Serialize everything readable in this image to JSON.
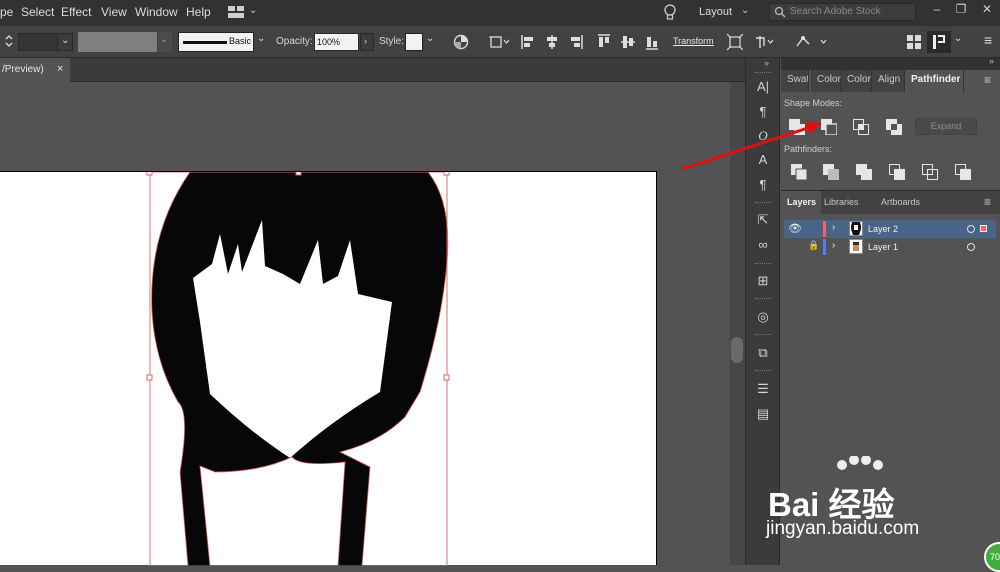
{
  "menubar": {
    "items": [
      "pe",
      "Select",
      "Effect",
      "View",
      "Window",
      "Help"
    ],
    "workspace": "Layout",
    "search_placeholder": "Search Adobe Stock"
  },
  "controlbar": {
    "stroke_style": "Basic",
    "opacity_label": "Opacity:",
    "opacity_value": "100%",
    "style_label": "Style:",
    "transform_label": "Transform"
  },
  "document": {
    "tab_label": "/Preview)",
    "tab_close": "×"
  },
  "tools": [
    "character-icon",
    "paragraph-icon",
    "opentype-icon",
    "glyphs-icon",
    "paragraph-styles-icon",
    "export-icon",
    "links-icon",
    "artboards-icon",
    "appearance-icon",
    "asset-export-icon",
    "align-icon",
    "gradient-icon"
  ],
  "panel_tabs": [
    "Swatc",
    "Color",
    "Color",
    "Align",
    "Pathfinder"
  ],
  "pathfinder": {
    "shape_modes_label": "Shape Modes:",
    "pathfinders_label": "Pathfinders:",
    "expand_label": "Expand"
  },
  "layers": {
    "tabs": [
      "Layers",
      "Libraries",
      "Artboards"
    ],
    "rows": [
      {
        "name": "Layer 2",
        "color": "#ff5e5e",
        "selected": true
      },
      {
        "name": "Layer 1",
        "color": "#4f7bff",
        "selected": false
      }
    ]
  },
  "watermark": {
    "brand": "Bai 经验",
    "url": "jingyan.baidu.com",
    "corner": "70"
  },
  "colors": {
    "menubar": "#323232",
    "panel": "#535353",
    "accent_arrow": "#e01010",
    "selection": "#e06060"
  }
}
